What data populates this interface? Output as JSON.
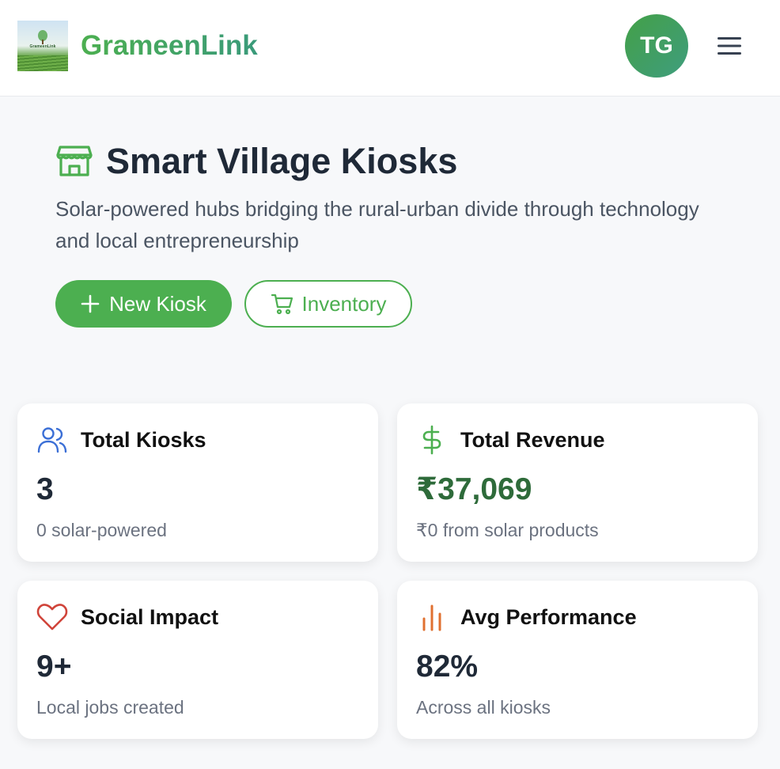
{
  "header": {
    "logo_text": "GrameenLink",
    "brand": "GrameenLink",
    "avatar_initials": "TG",
    "menu_icon": "hamburger-menu-icon"
  },
  "hero": {
    "icon": "store-icon",
    "title": "Smart Village Kiosks",
    "subtitle": "Solar-powered hubs bridging the rural-urban divide through technology and local entrepreneurship",
    "new_kiosk_label": "New Kiosk",
    "inventory_label": "Inventory"
  },
  "stats": [
    {
      "icon": "users-icon",
      "title": "Total Kiosks",
      "value": "3",
      "sub": "0 solar-powered",
      "accent": "#3b6fd6"
    },
    {
      "icon": "dollar-icon",
      "title": "Total Revenue",
      "value": "₹37,069",
      "sub": "₹0 from solar products",
      "accent": "#4caf50"
    },
    {
      "icon": "heart-icon",
      "title": "Social Impact",
      "value": "9+",
      "sub": "Local jobs created",
      "accent": "#d0443a"
    },
    {
      "icon": "bar-chart-icon",
      "title": "Avg Performance",
      "value": "82%",
      "sub": "Across all kiosks",
      "accent": "#e07030"
    }
  ],
  "colors": {
    "brand_green": "#4caf50",
    "revenue_green": "#2e6b3a"
  }
}
